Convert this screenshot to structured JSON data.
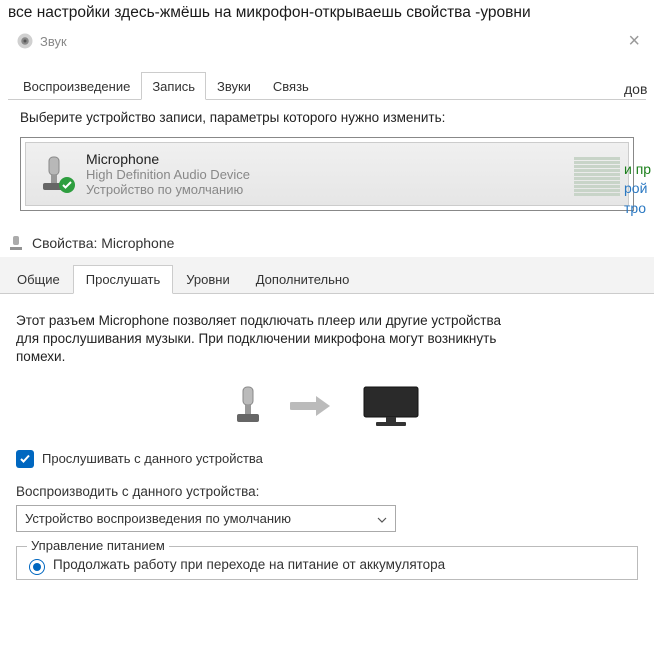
{
  "instruction_text": "все настройки здесь-жмёшь на микрофон-открываешь свойства -уровни",
  "sound_window": {
    "title": "Звук",
    "tabs": [
      "Воспроизведение",
      "Запись",
      "Звуки",
      "Связь"
    ],
    "active_tab_index": 1,
    "prompt": "Выберите устройство записи, параметры которого нужно изменить:",
    "device": {
      "name": "Microphone",
      "description": "High Definition Audio Device",
      "status": "Устройство по умолчанию"
    }
  },
  "side_fragments": {
    "a": "дов",
    "b": "и пр",
    "c": "рой",
    "d": "тро"
  },
  "props_window": {
    "title": "Свойства: Microphone",
    "tabs": [
      "Общие",
      "Прослушать",
      "Уровни",
      "Дополнительно"
    ],
    "active_tab_index": 1,
    "listen": {
      "description": "Этот разъем Microphone позволяет подключать плеер или другие устройства для прослушивания музыки. При подключении микрофона могут возникнуть помехи.",
      "checkbox_label": "Прослушивать с данного устройства",
      "checkbox_checked": true,
      "playback_label": "Воспроизводить с данного устройства:",
      "dropdown_value": "Устройство воспроизведения по умолчанию",
      "power_group_label": "Управление питанием",
      "radio1_label": "Продолжать работу при переходе на питание от аккумулятора",
      "radio1_checked": true
    }
  }
}
